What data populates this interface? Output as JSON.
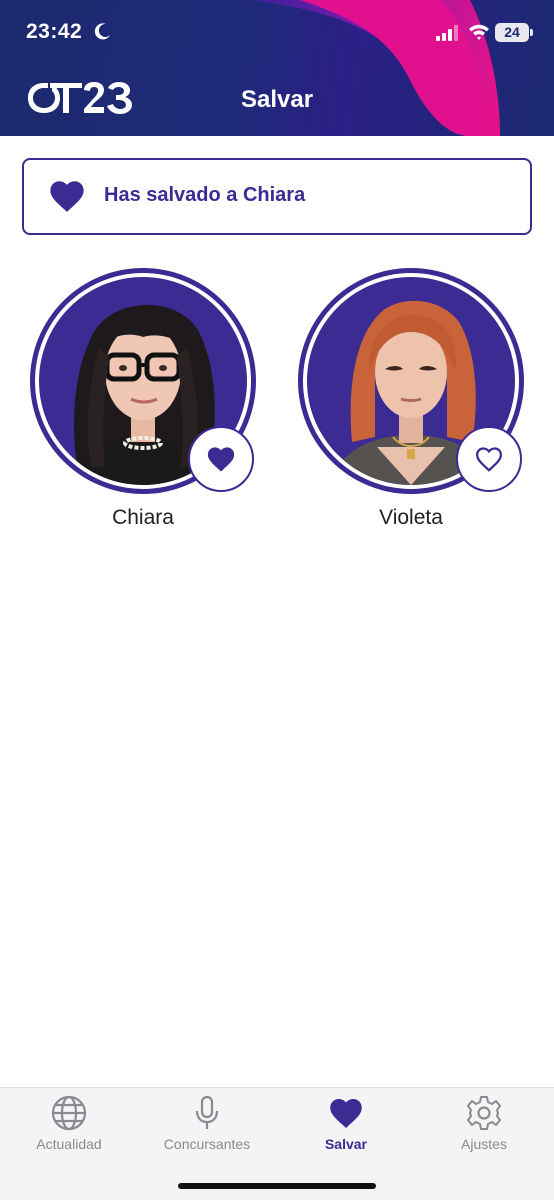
{
  "status": {
    "time": "23:42",
    "battery": "24"
  },
  "header": {
    "logo_text": "OT23",
    "title": "Salvar"
  },
  "banner": {
    "text": "Has salvado a Chiara",
    "icon": "heart-filled-icon"
  },
  "contestants": [
    {
      "name": "Chiara",
      "saved": true,
      "icon": "heart-filled-icon"
    },
    {
      "name": "Violeta",
      "saved": false,
      "icon": "heart-outline-icon"
    }
  ],
  "tabs": [
    {
      "label": "Actualidad",
      "icon": "globe-icon",
      "active": false
    },
    {
      "label": "Concursantes",
      "icon": "microphone-icon",
      "active": false
    },
    {
      "label": "Salvar",
      "icon": "heart-icon",
      "active": true
    },
    {
      "label": "Ajustes",
      "icon": "gear-icon",
      "active": false
    }
  ],
  "colors": {
    "accent": "#3d2b94",
    "header_bg": "#1c2a6e",
    "swirl": "#e0108f",
    "inactive": "#8a8a8e"
  }
}
